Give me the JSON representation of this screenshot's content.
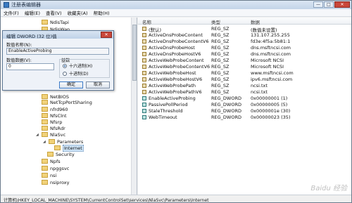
{
  "window": {
    "title": "注册表编辑器",
    "min": "—",
    "max": "□",
    "close": "✕"
  },
  "menu": [
    "文件(F)",
    "编辑(E)",
    "查看(V)",
    "收藏夹(A)",
    "帮助(H)"
  ],
  "tree": [
    {
      "label": "NdisTapi",
      "selected": false
    },
    {
      "label": "NdisWan",
      "selected": false
    },
    {
      "label": "NetBIOS",
      "selected": false
    },
    {
      "label": "NetTcpPortSharing",
      "selected": false
    },
    {
      "label": "nfrd960",
      "selected": false
    },
    {
      "label": "NfsClnt",
      "selected": false
    },
    {
      "label": "Nfsrp",
      "selected": false
    },
    {
      "label": "NfsRdr",
      "selected": false
    },
    {
      "label": "NlaSvc",
      "selected": false
    },
    {
      "label": "Parameters",
      "selected": false
    },
    {
      "label": "Internet",
      "selected": true
    },
    {
      "label": "Security",
      "selected": false
    },
    {
      "label": "Npfs",
      "selected": false
    },
    {
      "label": "npggsvc",
      "selected": false
    },
    {
      "label": "nsi",
      "selected": false
    },
    {
      "label": "nsiproxy",
      "selected": false
    }
  ],
  "list": {
    "headers": {
      "name": "名称",
      "type": "类型",
      "data": "数据"
    },
    "rows": [
      {
        "name": "(默认)",
        "type": "REG_SZ",
        "data": "(数值未设置)",
        "kind": "sz"
      },
      {
        "name": "ActiveDnsProbeContent",
        "type": "REG_SZ",
        "data": "131.107.255.255",
        "kind": "sz"
      },
      {
        "name": "ActiveDnsProbeContentV6",
        "type": "REG_SZ",
        "data": "fd3e:4f5a:5b81:1",
        "kind": "sz"
      },
      {
        "name": "ActiveDnsProbeHost",
        "type": "REG_SZ",
        "data": "dns.msftncsi.com",
        "kind": "sz"
      },
      {
        "name": "ActiveDnsProbeHostV6",
        "type": "REG_SZ",
        "data": "dns.msftncsi.com",
        "kind": "sz"
      },
      {
        "name": "ActiveWebProbeContent",
        "type": "REG_SZ",
        "data": "Microsoft NCSI",
        "kind": "sz"
      },
      {
        "name": "ActiveWebProbeContentV6",
        "type": "REG_SZ",
        "data": "Microsoft NCSI",
        "kind": "sz"
      },
      {
        "name": "ActiveWebProbeHost",
        "type": "REG_SZ",
        "data": "www.msftncsi.com",
        "kind": "sz"
      },
      {
        "name": "ActiveWebProbeHostV6",
        "type": "REG_SZ",
        "data": "ipv6.msftncsi.com",
        "kind": "sz"
      },
      {
        "name": "ActiveWebProbePath",
        "type": "REG_SZ",
        "data": "ncsi.txt",
        "kind": "sz"
      },
      {
        "name": "ActiveWebProbePathV6",
        "type": "REG_SZ",
        "data": "ncsi.txt",
        "kind": "sz"
      },
      {
        "name": "EnableActiveProbing",
        "type": "REG_DWORD",
        "data": "0x00000001 (1)",
        "kind": "dw"
      },
      {
        "name": "PassivePollPeriod",
        "type": "REG_DWORD",
        "data": "0x00000005 (5)",
        "kind": "dw"
      },
      {
        "name": "StaleThreshold",
        "type": "REG_DWORD",
        "data": "0x0000001e (30)",
        "kind": "dw"
      },
      {
        "name": "WebTimeout",
        "type": "REG_DWORD",
        "data": "0x00000023 (35)",
        "kind": "dw"
      }
    ]
  },
  "status": "计算机\\HKEY_LOCAL_MACHINE\\SYSTEM\\CurrentControlSet\\services\\NlaSvc\\Parameters\\Internet",
  "dialog": {
    "title": "编辑 DWORD (32 位)值",
    "close": "✕",
    "name_label": "数值名称(N):",
    "name_value": "EnableActiveProbing",
    "data_label": "数值数据(V):",
    "data_value": "0",
    "base_label": "基数",
    "hex_label": "十六进制(H)",
    "dec_label": "十进制(D)",
    "ok": "确定",
    "cancel": "取消"
  },
  "watermark": "Baidu 经验"
}
